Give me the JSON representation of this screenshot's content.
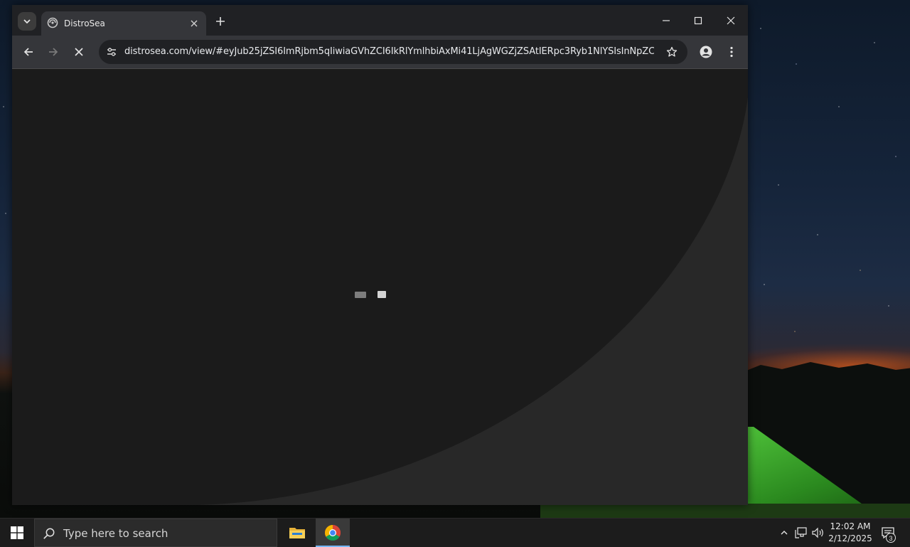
{
  "browser": {
    "tab": {
      "title": "DistroSea",
      "favicon": "distrosea-icon"
    },
    "new_tab_symbol": "+",
    "omnibox": {
      "url": "distrosea.com/view/#eyJub25jZSI6ImRjbm5qIiwiaGVhZCI6IkRlYmlhbiAxMi41LjAgWGZjZSAtIERpc3Ryb1NlYSIsInNpZCI6I..."
    },
    "loading": true,
    "colors": {
      "titlebar": "#202124",
      "toolbar": "#35363a",
      "omnibox": "#202124",
      "page": "#1b1b1b"
    }
  },
  "taskbar": {
    "search_placeholder": "Type here to search",
    "pinned_apps": [
      "file-explorer",
      "chrome"
    ],
    "clock_time": "12:02 AM",
    "clock_date": "2/12/2025",
    "notification_count": "3"
  }
}
